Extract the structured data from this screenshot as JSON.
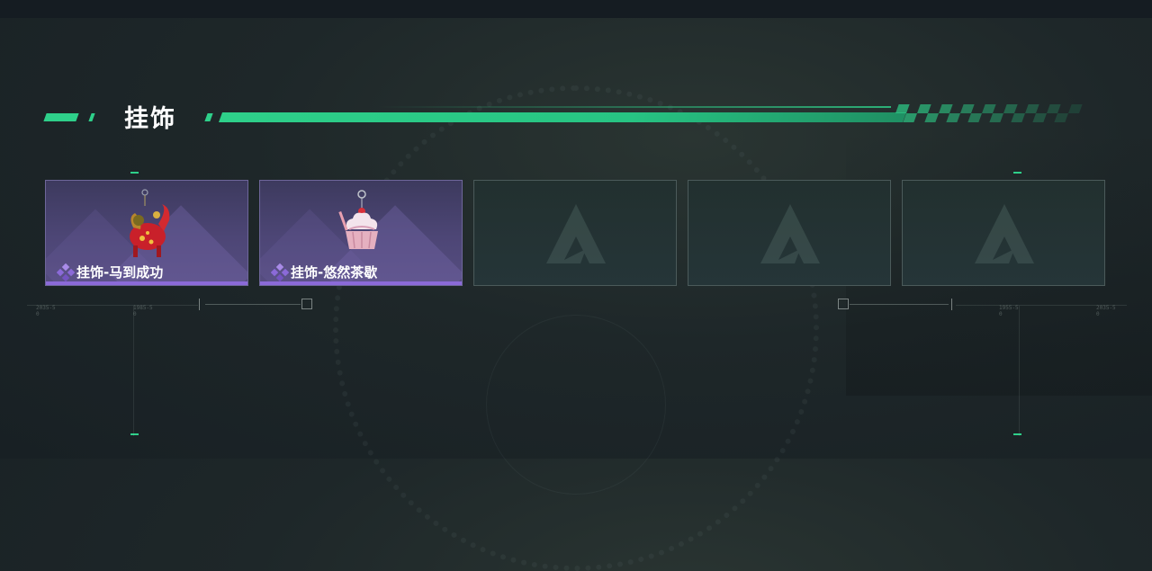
{
  "section": {
    "title": "挂饰"
  },
  "items": [
    {
      "state": "filled",
      "name": "挂饰-马到成功",
      "art_icon": "red-horse-charm-icon"
    },
    {
      "state": "filled",
      "name": "挂饰-悠然茶歇",
      "art_icon": "cupcake-charm-icon"
    },
    {
      "state": "empty",
      "placeholder_icon": "game-logo-icon"
    },
    {
      "state": "empty",
      "placeholder_icon": "game-logo-icon"
    },
    {
      "state": "empty",
      "placeholder_icon": "game-logo-icon"
    }
  ],
  "decor_labels": {
    "left_a": "2035-5\n0",
    "left_b": "1985-5\n0",
    "right_a": "1955-5\n0",
    "right_b": "2035-5\n0"
  },
  "colors": {
    "accent": "#2ed08a",
    "rare_purple": "#8b6ad8",
    "card_purple": "#4d4676",
    "empty_slot": "#253538"
  }
}
